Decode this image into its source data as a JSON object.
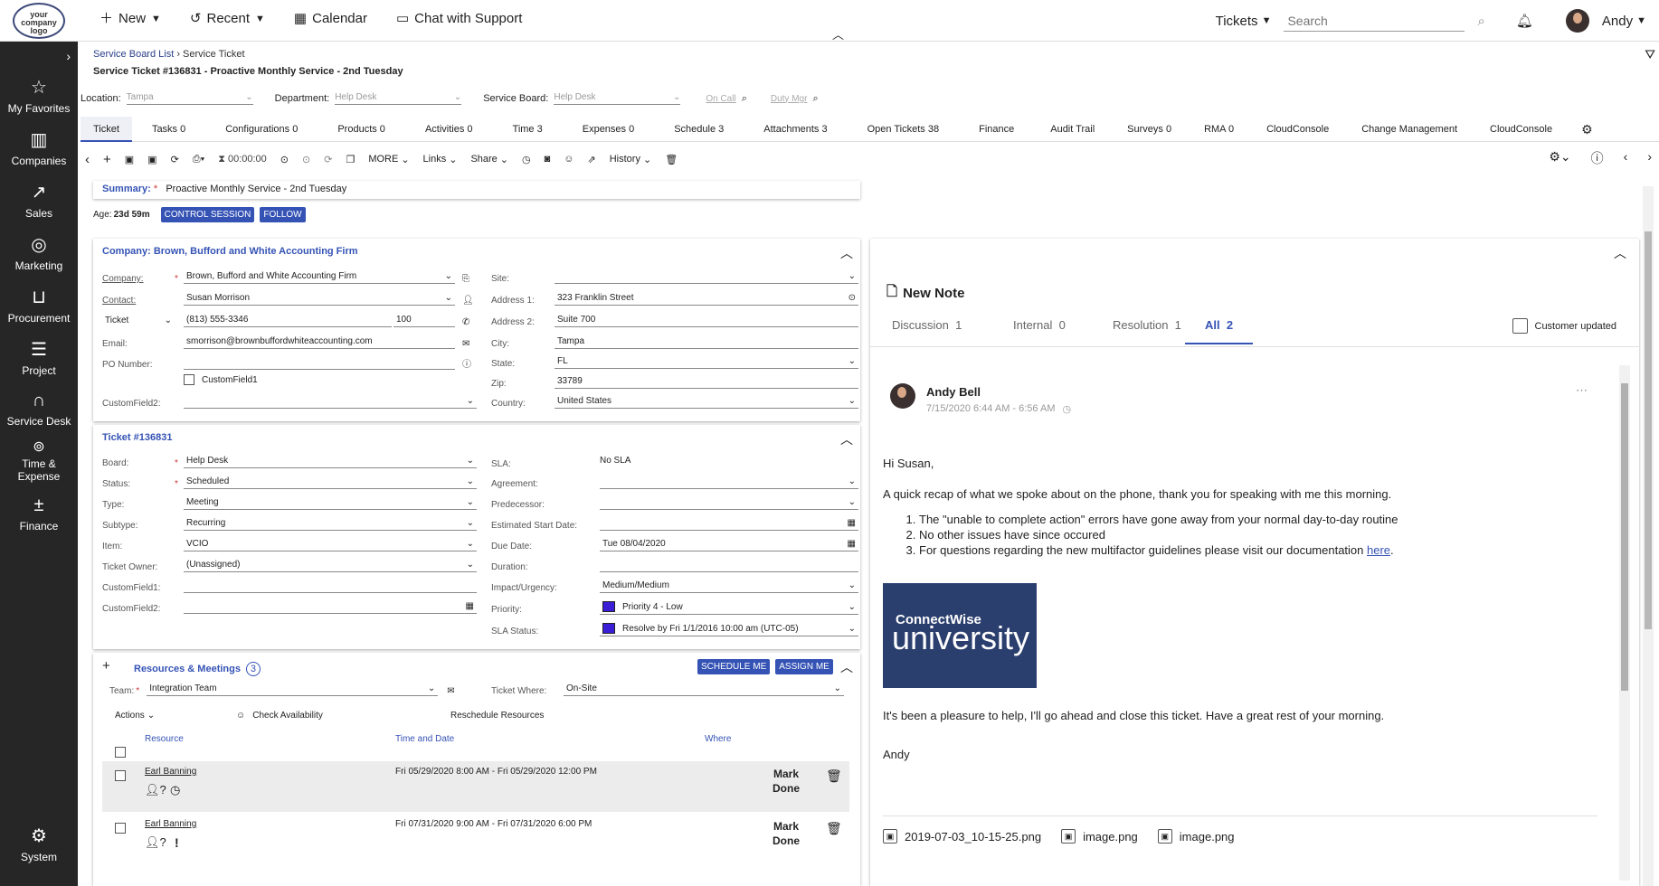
{
  "topbar": {
    "logo_text": "your company logo",
    "nav": [
      {
        "label": "New"
      },
      {
        "label": "Recent"
      },
      {
        "label": "Calendar"
      },
      {
        "label": "Chat with Support"
      }
    ],
    "tickets_label": "Tickets",
    "search_placeholder": "Search",
    "user": "Andy"
  },
  "sidebar": {
    "items": [
      {
        "label": "My Favorites",
        "icon": "star-icon"
      },
      {
        "label": "Companies",
        "icon": "building-icon"
      },
      {
        "label": "Sales",
        "icon": "chart-icon"
      },
      {
        "label": "Marketing",
        "icon": "target-icon"
      },
      {
        "label": "Procurement",
        "icon": "cart-icon"
      },
      {
        "label": "Project",
        "icon": "project-icon"
      },
      {
        "label": "Service Desk",
        "icon": "headset-icon"
      },
      {
        "label": "Time & Expense",
        "icon": "time-icon"
      },
      {
        "label": "Finance",
        "icon": "calculator-icon"
      },
      {
        "label": "System",
        "icon": "gear-icon"
      }
    ]
  },
  "breadcrumb": {
    "link": "Service Board List",
    "current": "Service Ticket"
  },
  "ticket_title": "Service Ticket #136831 - Proactive Monthly Service - 2nd Tuesday",
  "filters": {
    "location_label": "Location:",
    "location_value": "Tampa",
    "department_label": "Department:",
    "department_value": "Help Desk",
    "board_label": "Service Board:",
    "board_value": "Help Desk",
    "oncall": "On Call",
    "dutymgr": "Duty Mgr"
  },
  "tabs": [
    {
      "label": "Ticket"
    },
    {
      "label": "Tasks 0"
    },
    {
      "label": "Configurations 0"
    },
    {
      "label": "Products 0"
    },
    {
      "label": "Activities 0"
    },
    {
      "label": "Time 3"
    },
    {
      "label": "Expenses 0"
    },
    {
      "label": "Schedule 3"
    },
    {
      "label": "Attachments 3"
    },
    {
      "label": "Open Tickets 38"
    },
    {
      "label": "Finance"
    },
    {
      "label": "Audit Trail"
    },
    {
      "label": "Surveys 0"
    },
    {
      "label": "RMA 0"
    },
    {
      "label": "CloudConsole"
    },
    {
      "label": "Change Management"
    },
    {
      "label": "CloudConsole"
    }
  ],
  "toolbar": {
    "timer": "00:00:00",
    "more": "MORE",
    "links": "Links",
    "share": "Share",
    "history": "History"
  },
  "summary": {
    "label": "Summary:",
    "value": "Proactive Monthly Service - 2nd Tuesday"
  },
  "age": {
    "label": "Age:",
    "value": "23d 59m",
    "control": "CONTROL SESSION",
    "follow": "FOLLOW"
  },
  "company": {
    "header": "Company: Brown, Bufford and White Accounting Firm",
    "company_label": "Company:",
    "company_value": "Brown, Bufford and White Accounting Firm",
    "contact_label": "Contact:",
    "contact_value": "Susan Morrison",
    "phone_type": "Ticket",
    "phone_value": "(813) 555-3346",
    "phone_ext": "100",
    "email_label": "Email:",
    "email_value": "smorrison@brownbuffordwhiteaccounting.com",
    "po_label": "PO Number:",
    "cf1_label": "CustomField1",
    "cf2_label": "CustomField2:",
    "site_label": "Site:",
    "addr1_label": "Address 1:",
    "addr1_value": "323 Franklin Street",
    "addr2_label": "Address 2:",
    "addr2_value": "Suite 700",
    "city_label": "City:",
    "city_value": "Tampa",
    "state_label": "State:",
    "state_value": "FL",
    "zip_label": "Zip:",
    "zip_value": "33789",
    "country_label": "Country:",
    "country_value": "United States"
  },
  "ticket": {
    "header": "Ticket #136831",
    "board_label": "Board:",
    "board_value": "Help Desk",
    "status_label": "Status:",
    "status_value": "Scheduled",
    "type_label": "Type:",
    "type_value": "Meeting",
    "subtype_label": "Subtype:",
    "subtype_value": "Recurring",
    "item_label": "Item:",
    "item_value": "VCIO",
    "owner_label": "Ticket Owner:",
    "owner_value": "(Unassigned)",
    "cf1_label": "CustomField1:",
    "cf2_label": "CustomField2:",
    "sla_label": "SLA:",
    "sla_value": "No SLA",
    "agreement_label": "Agreement:",
    "predecessor_label": "Predecessor:",
    "est_label": "Estimated Start Date:",
    "due_label": "Due Date:",
    "due_value": "Tue 08/04/2020",
    "duration_label": "Duration:",
    "impact_label": "Impact/Urgency:",
    "impact_value": "Medium/Medium",
    "priority_label": "Priority:",
    "priority_value": "Priority 4 - Low",
    "slastatus_label": "SLA Status:",
    "slastatus_value": "Resolve by Fri 1/1/2016 10:00 am (UTC-05)",
    "priority_color": "#3a1fd6"
  },
  "resources": {
    "header": "Resources & Meetings",
    "count": "3",
    "schedule": "SCHEDULE ME",
    "assign": "ASSIGN ME",
    "team_label": "Team:",
    "team_value": "Integration Team",
    "where_label": "Ticket Where:",
    "where_value": "On-Site",
    "actions": "Actions",
    "check_avail": "Check Availability",
    "reschedule": "Reschedule Resources",
    "col_resource": "Resource",
    "col_time": "Time and Date",
    "col_where": "Where",
    "rows": [
      {
        "name": "Earl Banning",
        "time": "Fri 05/29/2020 8:00 AM - Fri 05/29/2020 12:00 PM",
        "action": "Mark Done"
      },
      {
        "name": "Earl Banning",
        "time": "Fri 07/31/2020 9:00 AM - Fri 07/31/2020 6:00 PM",
        "action": "Mark Done"
      }
    ]
  },
  "notes": {
    "new_note": "New Note",
    "tabs": [
      {
        "label": "Discussion",
        "count": "1"
      },
      {
        "label": "Internal",
        "count": "0"
      },
      {
        "label": "Resolution",
        "count": "1"
      },
      {
        "label": "All",
        "count": "2"
      }
    ],
    "customer_updated": "Customer updated",
    "author": "Andy Bell",
    "timestamp": "7/15/2020 6:44 AM - 6:56 AM",
    "greeting": "Hi Susan,",
    "intro": "A quick recap of what we spoke about on the phone, thank you for speaking with me this morning.",
    "items": [
      "The \"unable to complete action\" errors have gone away from your normal day-to-day routine",
      "No other issues have since occured",
      "For questions regarding the new multifactor guidelines please visit our documentation "
    ],
    "link_text": "here",
    "image_line1": "ConnectWise",
    "image_line2": "university",
    "closing": "It's been a pleasure to help, I'll go ahead and close this ticket. Have a great rest of your morning.",
    "signoff": "Andy",
    "attachments": [
      "2019-07-03_10-15-25.png",
      "image.png",
      "image.png"
    ]
  }
}
